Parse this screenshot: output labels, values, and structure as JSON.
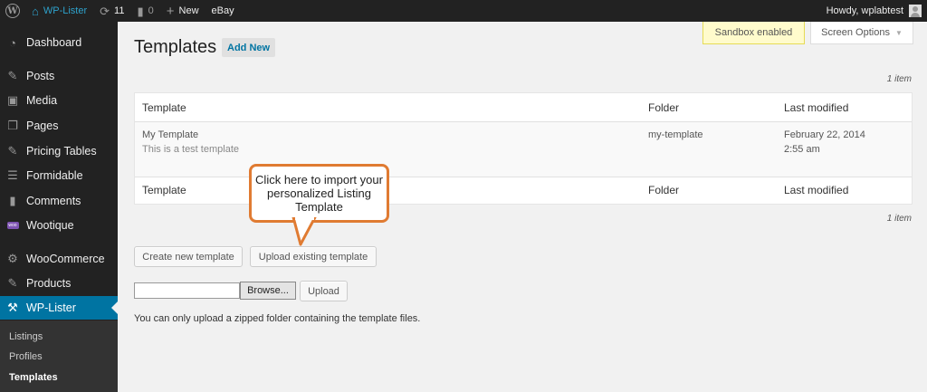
{
  "admin_bar": {
    "site_name": "WP-Lister",
    "updates_count": "11",
    "comments_count": "0",
    "new_label": "New",
    "ebay_label": "eBay",
    "howdy": "Howdy, wplabtest"
  },
  "sidebar": {
    "items": [
      {
        "label": "Dashboard",
        "icon": "dashboard-icon"
      },
      {
        "label": "Posts",
        "icon": "pin-icon"
      },
      {
        "label": "Media",
        "icon": "media-icon"
      },
      {
        "label": "Pages",
        "icon": "pages-icon"
      },
      {
        "label": "Pricing Tables",
        "icon": "pin-icon"
      },
      {
        "label": "Formidable",
        "icon": "list-icon"
      },
      {
        "label": "Comments",
        "icon": "comment-icon"
      },
      {
        "label": "Wootique",
        "icon": "woo-icon"
      },
      {
        "label": "WooCommerce",
        "icon": "gear-icon"
      },
      {
        "label": "Products",
        "icon": "pin-icon"
      },
      {
        "label": "WP-Lister",
        "icon": "hammer-icon"
      }
    ],
    "submenu": [
      {
        "label": "Listings"
      },
      {
        "label": "Profiles"
      },
      {
        "label": "Templates"
      }
    ]
  },
  "header": {
    "title": "Templates",
    "add_new": "Add New",
    "sandbox": "Sandbox enabled",
    "screen_options": "Screen Options"
  },
  "table": {
    "count_top": "1 item",
    "count_bottom": "1 item",
    "columns": [
      "Template",
      "Folder",
      "Last modified"
    ],
    "rows": [
      {
        "name": "My Template",
        "description": "This is a test template",
        "folder": "my-template",
        "date": "February 22, 2014",
        "time": "2:55 am"
      }
    ]
  },
  "actions": {
    "create": "Create new template",
    "upload_existing": "Upload existing template",
    "browse": "Browse...",
    "upload": "Upload",
    "help": "You can only upload a zipped folder containing the template files."
  },
  "callout": {
    "text": "Click here to import your personalized Listing Template"
  },
  "colors": {
    "accent": "#0074a2",
    "callout_border": "#e07b32",
    "sidebar_bg": "#222222"
  }
}
